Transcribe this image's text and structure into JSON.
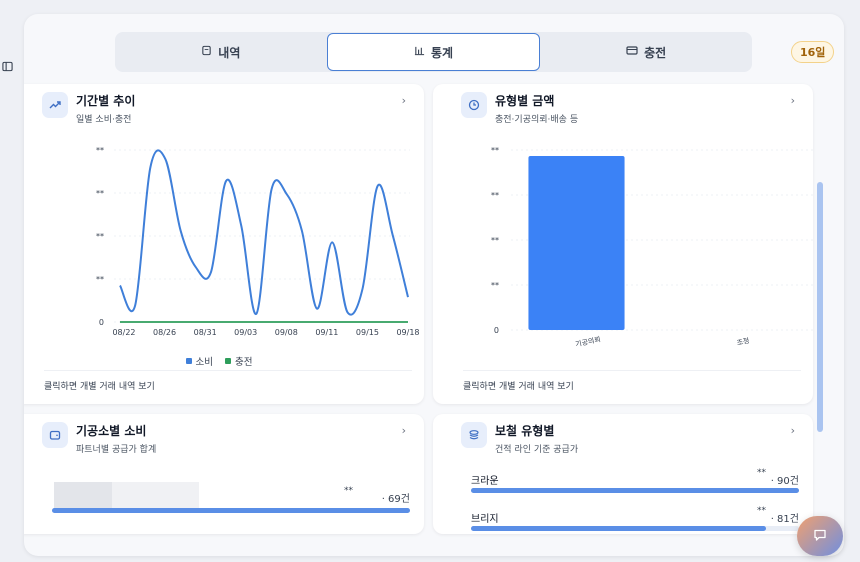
{
  "tabs": [
    {
      "label": "내역",
      "icon": "receipt-icon",
      "active": false
    },
    {
      "label": "통계",
      "icon": "bar-chart-icon",
      "active": true
    },
    {
      "label": "충전",
      "icon": "card-icon",
      "active": false
    }
  ],
  "badge": "16일",
  "cards": {
    "trend": {
      "title": "기간별 추이",
      "subtitle": "일별 소비·충전",
      "icon": "trending-up-icon",
      "footer": "클릭하면 개별 거래 내역 보기"
    },
    "type_amount": {
      "title": "유형별 금액",
      "subtitle": "충전·기공의뢰·배송 등",
      "icon": "clock-icon",
      "footer": "클릭하면 개별 거래 내역 보기"
    },
    "lab_spend": {
      "title": "기공소별 소비",
      "subtitle": "파트너별 공급가 합계",
      "icon": "wallet-icon",
      "rows": [
        {
          "mask": "**",
          "count": "· 69건",
          "fill": 1.0
        }
      ]
    },
    "prosthesis": {
      "title": "보철 유형별",
      "subtitle": "건적 라인 기준 공급가",
      "icon": "layers-icon",
      "rows": [
        {
          "label": "크라운",
          "mask": "**",
          "count": "· 90건",
          "fill": 1.0
        },
        {
          "label": "브리지",
          "mask": "**",
          "count": "· 81건",
          "fill": 0.9
        }
      ]
    }
  },
  "colors": {
    "consume": "#3f7fd9",
    "charge": "#2e9e5b",
    "bar": "#3b82f6",
    "accent": "#4a7fd4"
  },
  "chart_data": [
    {
      "type": "line",
      "x_tick_labels": [
        "08/22",
        "08/26",
        "08/31",
        "09/03",
        "09/08",
        "09/11",
        "09/15",
        "09/18"
      ],
      "y_tick_labels": [
        "**",
        "**",
        "**",
        "**",
        "0"
      ],
      "series": [
        {
          "name": "소비",
          "color": "#3f7fd9",
          "values": [
            0.22,
            0.1,
            0.93,
            0.98,
            0.55,
            0.33,
            0.3,
            0.85,
            0.58,
            0.05,
            0.8,
            0.77,
            0.55,
            0.08,
            0.48,
            0.06,
            0.2,
            0.82,
            0.52,
            0.15
          ]
        },
        {
          "name": "충전",
          "color": "#2e9e5b",
          "values": [
            0,
            0,
            0,
            0,
            0,
            0,
            0,
            0,
            0,
            0,
            0,
            0,
            0,
            0,
            0,
            0,
            0,
            0,
            0,
            0
          ]
        }
      ],
      "legend": "bottom-center"
    },
    {
      "type": "bar",
      "categories": [
        "기공의뢰",
        "조정"
      ],
      "values": [
        1.0,
        0
      ],
      "y_tick_labels": [
        "**",
        "**",
        "**",
        "**",
        "0"
      ],
      "color": "#3b82f6"
    }
  ]
}
